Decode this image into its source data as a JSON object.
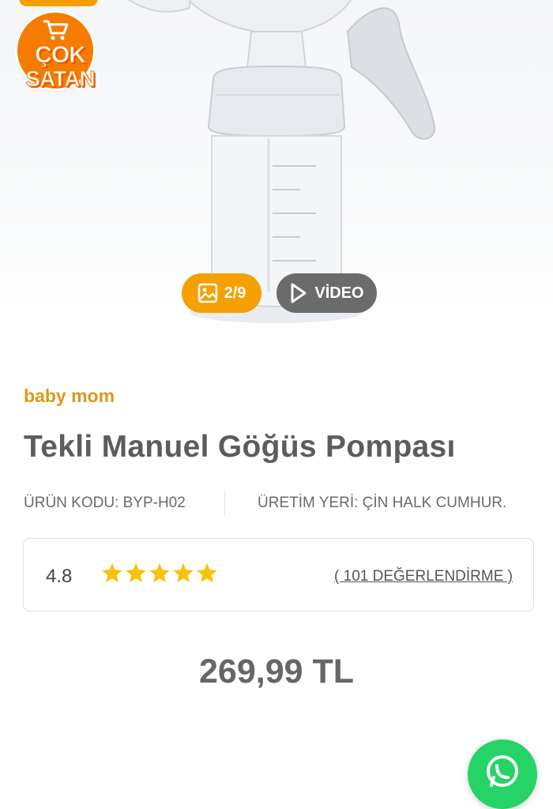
{
  "badge": {
    "line1": "ÇOK",
    "line2": "SATAN",
    "icon": "shopping-cart-icon"
  },
  "gallery": {
    "counter": "2/9",
    "counter_icon": "image-icon",
    "video_label": "VİDEO",
    "video_icon": "play-icon"
  },
  "product": {
    "brand": "baby mom",
    "title": "Tekli Manuel Göğüs Pompası",
    "code_label": "ÜRÜN KODU: BYP-H02",
    "origin_label": "ÜRETİM YERİ: ÇİN HALK CUMHUR.",
    "rating": {
      "score": "4.8",
      "stars": 5,
      "reviews": "( 101 DEĞERLENDİRME )"
    },
    "price": "269,99 TL"
  },
  "colors": {
    "badge_orange": "#f57c00",
    "counter_pill": "#f5a000",
    "video_pill": "#6b6b6b",
    "brand_text": "#d99a1a",
    "star": "#f8c20b",
    "whatsapp": "#25d366"
  },
  "floating": {
    "whatsapp_icon": "whatsapp-icon"
  }
}
